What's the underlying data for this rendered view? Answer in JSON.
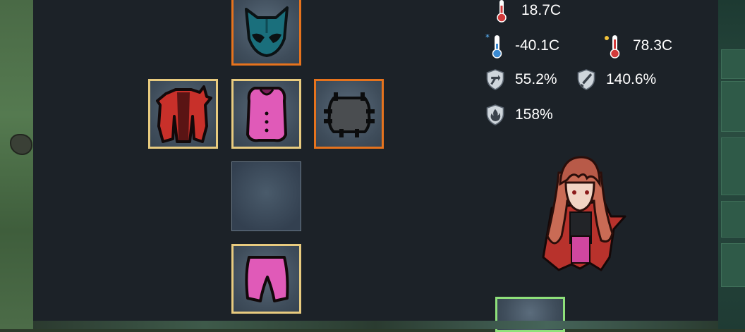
{
  "stats": {
    "temperature": "18.7C",
    "min_temperature": "-40.1C",
    "max_temperature": "78.3C",
    "sharp_armor": "55.2%",
    "blunt_armor": "140.6%",
    "heat_armor": "158%"
  },
  "equipment_slots": [
    {
      "slot": "head",
      "item": "teal-mask",
      "border": "orange"
    },
    {
      "slot": "outer-torso",
      "item": "red-cape-coat",
      "border": "gold"
    },
    {
      "slot": "middle-torso",
      "item": "pink-vest",
      "border": "gold"
    },
    {
      "slot": "belt",
      "item": "black-armor-plate",
      "border": "orange"
    },
    {
      "slot": "empty",
      "item": "",
      "border": "none"
    },
    {
      "slot": "legs",
      "item": "pink-pants",
      "border": "gold"
    },
    {
      "slot": "extra",
      "item": "",
      "border": "green"
    }
  ],
  "colors": {
    "panel_bg": "#1c2228",
    "gold_border": "#e8cb7f",
    "orange_border": "#e6731d",
    "green_border": "#8ee07a"
  }
}
